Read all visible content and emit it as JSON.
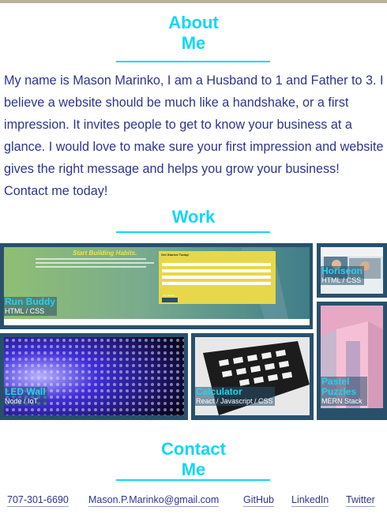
{
  "about": {
    "heading_line1": "About",
    "heading_line2": "Me",
    "text": "My name is Mason Marinko, I am a Husband to 1 and Father to 3. I believe a website should be much like a handshake, or a first impression. It invites people to get to know your business at a glance. I would love to make sure your first impression and website gives the right message and helps you grow your business! Contact me today!"
  },
  "work": {
    "heading": "Work",
    "projects": [
      {
        "name": "Run Buddy",
        "tech": "HTML / CSS",
        "banner": "Start Building Habits.",
        "form_title": "Get Started Today!",
        "button": "Get Started"
      },
      {
        "name": "Horiseon",
        "tech": "HTML / CSS"
      },
      {
        "name": "LED Wall",
        "tech": "Node / IoT"
      },
      {
        "name": "Calculator",
        "tech": "React / Javascript / CSS"
      },
      {
        "name": "Pastel Puzzles",
        "tech": "MERN Stack"
      }
    ]
  },
  "contact": {
    "heading_line1": "Contact",
    "heading_line2": "Me",
    "links": [
      "707-301-6690",
      "Mason.P.Marinko@gmail.com",
      "GitHub",
      "LinkedIn",
      "Twitter"
    ]
  },
  "colors": {
    "accent": "#13d6f6",
    "text": "#2d3490",
    "tile_border": "#29506b"
  }
}
